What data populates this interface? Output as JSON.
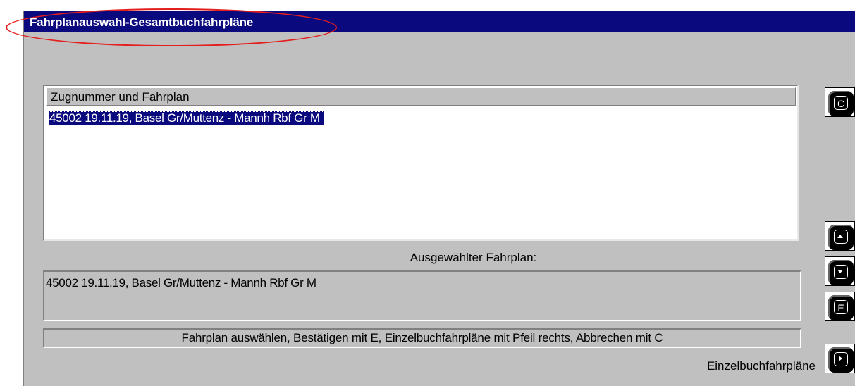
{
  "window": {
    "title": "Fahrplanauswahl-Gesamtbuchfahrpläne"
  },
  "list": {
    "header": "Zugnummer und Fahrplan",
    "items": [
      {
        "label": "45002 19.11.19, Basel Gr/Muttenz - Mannh Rbf Gr M",
        "selected": true
      }
    ]
  },
  "selection": {
    "label": "Ausgewählter Fahrplan:",
    "value": "45002 19.11.19, Basel Gr/Muttenz - Mannh Rbf Gr M"
  },
  "status": {
    "text": "Fahrplan auswählen, Bestätigen mit E, Einzelbuchfahrpläne mit Pfeil rechts, Abbrechen mit C"
  },
  "footer": {
    "einzel_label": "Einzelbuchfahrpläne"
  },
  "keys": {
    "cancel": "C",
    "up": "up-arrow",
    "down": "down-arrow",
    "enter": "E",
    "right": "right-arrow"
  },
  "colors": {
    "titlebar": "#0a0a7e",
    "dialog_bg": "#c0c0c0",
    "selection_bg": "#0a0a7e",
    "annotation": "#e41d1d"
  }
}
